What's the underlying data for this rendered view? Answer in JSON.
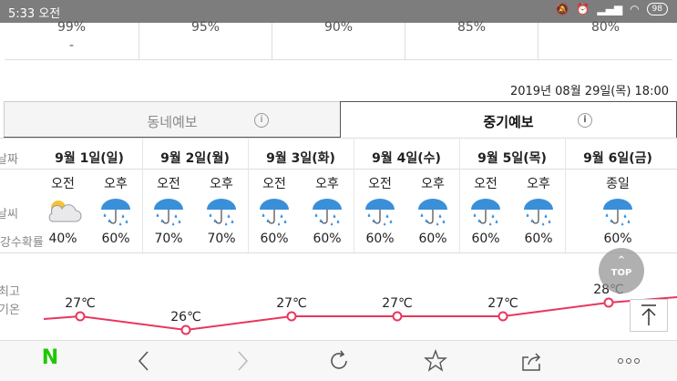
{
  "status_bar": {
    "time": "5:33 오전",
    "battery": "98"
  },
  "previous_row": [
    {
      "value": "99%",
      "dash": "-"
    },
    {
      "value": "95%"
    },
    {
      "value": "90%"
    },
    {
      "value": "85%"
    },
    {
      "value": "80%"
    }
  ],
  "issued_time": "2019년 08월 29일(목) 18:00",
  "tabs": [
    {
      "label": "동네예보",
      "info": "i",
      "active": false
    },
    {
      "label": "중기예보",
      "info": "i",
      "active": true
    }
  ],
  "row_labels": {
    "date": "날짜",
    "weather": "날씨",
    "precip": "강수확률",
    "max_temp_1": "최고",
    "max_temp_2": "기온"
  },
  "days": [
    {
      "date": "9월 1일(일)",
      "slots": [
        {
          "label": "오전",
          "icon": "partly-cloudy-icon",
          "prob": "40%"
        },
        {
          "label": "오후",
          "icon": "rain-umbrella-icon",
          "prob": "60%"
        }
      ],
      "max_temp": "27℃"
    },
    {
      "date": "9월 2일(월)",
      "slots": [
        {
          "label": "오전",
          "icon": "rain-umbrella-icon",
          "prob": "70%"
        },
        {
          "label": "오후",
          "icon": "rain-umbrella-icon",
          "prob": "70%"
        }
      ],
      "max_temp": "26℃"
    },
    {
      "date": "9월 3일(화)",
      "slots": [
        {
          "label": "오전",
          "icon": "rain-umbrella-icon",
          "prob": "60%"
        },
        {
          "label": "오후",
          "icon": "rain-umbrella-icon",
          "prob": "60%"
        }
      ],
      "max_temp": "27℃"
    },
    {
      "date": "9월 4일(수)",
      "slots": [
        {
          "label": "오전",
          "icon": "rain-umbrella-icon",
          "prob": "60%"
        },
        {
          "label": "오후",
          "icon": "rain-umbrella-icon",
          "prob": "60%"
        }
      ],
      "max_temp": "27℃"
    },
    {
      "date": "9월 5일(목)",
      "slots": [
        {
          "label": "오전",
          "icon": "rain-umbrella-icon",
          "prob": "60%"
        },
        {
          "label": "오후",
          "icon": "rain-umbrella-icon",
          "prob": "60%"
        }
      ],
      "max_temp": "27℃"
    },
    {
      "date": "9월 6일(금)",
      "slots": [
        {
          "label": "종일",
          "icon": "rain-umbrella-icon",
          "prob": "60%"
        }
      ],
      "max_temp": "28℃"
    }
  ],
  "chart_data": {
    "type": "line",
    "categories": [
      "9월 1일(일)",
      "9월 2일(월)",
      "9월 3일(화)",
      "9월 4일(수)",
      "9월 5일(목)",
      "9월 6일(금)"
    ],
    "series": [
      {
        "values": [
          27,
          26,
          27,
          27,
          27,
          28
        ]
      }
    ],
    "data_labels": [
      "27℃",
      "26℃",
      "27℃",
      "27℃",
      "27℃",
      "28℃"
    ],
    "color": "#e8365d"
  },
  "floating": {
    "top_label": "TOP",
    "top_arrow": "⌃"
  },
  "colors": {
    "accent_line": "#e8365d",
    "naver_green": "#1ec800",
    "umbrella_blue": "#3a8fd9"
  },
  "bottom_nav": {
    "logo": "N"
  }
}
